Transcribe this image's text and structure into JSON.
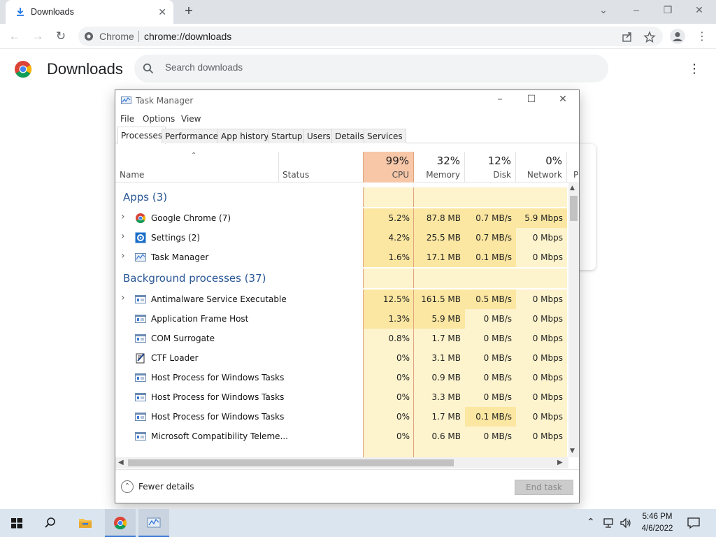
{
  "browser": {
    "tab_title": "Downloads",
    "omnibox_site": "Chrome",
    "omnibox_url": "chrome://downloads"
  },
  "downloads_page": {
    "title": "Downloads",
    "search_placeholder": "Search downloads"
  },
  "task_manager": {
    "title": "Task Manager",
    "menu": [
      "File",
      "Options",
      "View"
    ],
    "tabs": [
      "Processes",
      "Performance",
      "App history",
      "Startup",
      "Users",
      "Details",
      "Services"
    ],
    "active_tab": "Processes",
    "columns": {
      "name": "Name",
      "status": "Status",
      "cpu": {
        "pct": "99%",
        "label": "CPU"
      },
      "memory": {
        "pct": "32%",
        "label": "Memory"
      },
      "disk": {
        "pct": "12%",
        "label": "Disk"
      },
      "network": {
        "pct": "0%",
        "label": "Network"
      },
      "power_partial": "P"
    },
    "groups": {
      "apps": "Apps (3)",
      "background": "Background processes (37)"
    },
    "apps": [
      {
        "name": "Google Chrome (7)",
        "icon": "chrome-icon",
        "cpu": "5.2%",
        "memory": "87.8 MB",
        "disk": "0.7 MB/s",
        "network": "5.9 Mbps"
      },
      {
        "name": "Settings (2)",
        "icon": "settings-gear-icon",
        "cpu": "4.2%",
        "memory": "25.5 MB",
        "disk": "0.7 MB/s",
        "network": "0 Mbps"
      },
      {
        "name": "Task Manager",
        "icon": "task-manager-icon",
        "cpu": "1.6%",
        "memory": "17.1 MB",
        "disk": "0.1 MB/s",
        "network": "0 Mbps"
      }
    ],
    "background": [
      {
        "name": "Antimalware Service Executable",
        "cpu": "12.5%",
        "memory": "161.5 MB",
        "disk": "0.5 MB/s",
        "network": "0 Mbps"
      },
      {
        "name": "Application Frame Host",
        "cpu": "1.3%",
        "memory": "5.9 MB",
        "disk": "0 MB/s",
        "network": "0 Mbps"
      },
      {
        "name": "COM Surrogate",
        "cpu": "0.8%",
        "memory": "1.7 MB",
        "disk": "0 MB/s",
        "network": "0 Mbps"
      },
      {
        "name": "CTF Loader",
        "cpu": "0%",
        "memory": "3.1 MB",
        "disk": "0 MB/s",
        "network": "0 Mbps"
      },
      {
        "name": "Host Process for Windows Tasks",
        "cpu": "0%",
        "memory": "0.9 MB",
        "disk": "0 MB/s",
        "network": "0 Mbps"
      },
      {
        "name": "Host Process for Windows Tasks",
        "cpu": "0%",
        "memory": "3.3 MB",
        "disk": "0 MB/s",
        "network": "0 Mbps"
      },
      {
        "name": "Host Process for Windows Tasks",
        "cpu": "0%",
        "memory": "1.7 MB",
        "disk": "0.1 MB/s",
        "network": "0 Mbps"
      },
      {
        "name": "Microsoft Compatibility Teleme...",
        "cpu": "0%",
        "memory": "0.6 MB",
        "disk": "0 MB/s",
        "network": "0 Mbps"
      }
    ],
    "fewer_details": "Fewer details",
    "end_task": "End task"
  },
  "taskbar": {
    "time": "5:46 PM",
    "date": "4/6/2022"
  },
  "colors": {
    "cpu_header": "#f7c7a8",
    "heat_high": "#fbe7a1",
    "heat_low": "#fdf3cd",
    "group_title": "#2a5796"
  }
}
